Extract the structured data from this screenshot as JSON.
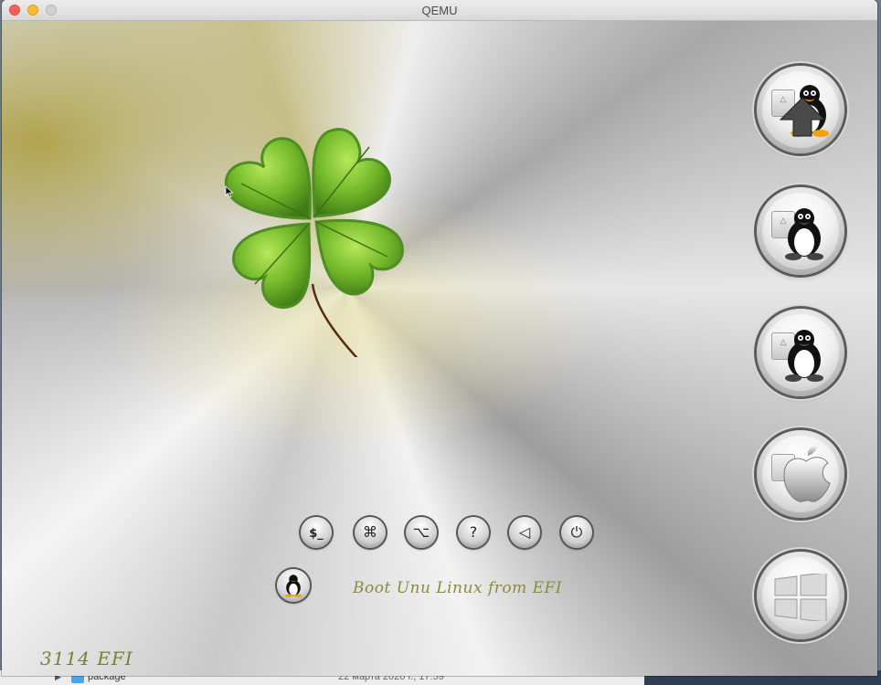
{
  "window": {
    "title": "QEMU"
  },
  "background_app": {
    "row_name": "package",
    "row_date": "22 марта 2020 г., 17:59"
  },
  "boot_entries": [
    {
      "name": "linux-entry-1",
      "icon": "tux-icon",
      "selected": true
    },
    {
      "name": "linux-entry-2",
      "icon": "tux-icon",
      "selected": false
    },
    {
      "name": "linux-entry-3",
      "icon": "tux-icon",
      "selected": false
    },
    {
      "name": "macos-entry",
      "icon": "apple-icon",
      "selected": false
    },
    {
      "name": "windows-entry",
      "icon": "windows-icon",
      "selected": false
    }
  ],
  "tools": [
    {
      "name": "shell",
      "glyph": "$_"
    },
    {
      "name": "command",
      "glyph": "⌘"
    },
    {
      "name": "option",
      "glyph": "⌥"
    },
    {
      "name": "help",
      "glyph": "?"
    },
    {
      "name": "back",
      "glyph": "◁"
    },
    {
      "name": "power",
      "glyph": "⏻"
    }
  ],
  "status": {
    "selected_label": "Boot Unu Linux from EFI",
    "corner_label": "3114 EFI"
  },
  "colors": {
    "accent_olive": "#8a8a40",
    "clover_green": "#6fb82e"
  }
}
